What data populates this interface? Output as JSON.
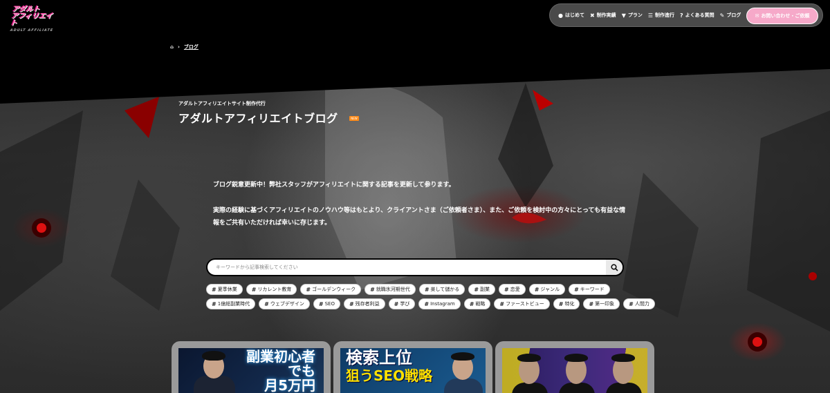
{
  "logo": {
    "text_line1": "アダルト",
    "text_line2": "アフィリエイト",
    "sub": "ADULT AFFILIATE"
  },
  "nav": {
    "items": [
      {
        "icon": "info-circle-icon",
        "glyph": "●",
        "label": "はじめて"
      },
      {
        "icon": "tools-icon",
        "glyph": "✖",
        "label": "制作実績"
      },
      {
        "icon": "funnel-icon",
        "glyph": "▼",
        "label": "プラン"
      },
      {
        "icon": "list-icon",
        "glyph": "☰",
        "label": "制作進行"
      },
      {
        "icon": "question-icon",
        "glyph": "?",
        "label": "よくある質問"
      },
      {
        "icon": "edit-icon",
        "glyph": "✎",
        "label": "ブログ"
      }
    ],
    "contact": {
      "icon": "mail-icon",
      "glyph": "✉",
      "label": "お問い合わせ・ご依頼"
    }
  },
  "breadcrumb": {
    "home_glyph": "⌂",
    "separator": "›",
    "current": "ブログ"
  },
  "hero": {
    "eyebrow": "アダルトアフィリエイトサイト制作代行",
    "title": "アダルトアフィリエイトブログ",
    "badge": "NEW",
    "intro_1": "ブログ鋭意更新中！弊社スタッフがアフィリエイトに関する記事を更新して参ります。",
    "intro_2": "実際の経験に基づくアフィリエイトのノウハウ等はもとより、クライアントさま（ご依頼者さま）、また、ご依頼を検討中の方々にとっても有益な情報をご共有いただければ幸いに存じます。"
  },
  "search": {
    "placeholder": "キーワードから記事検索してください",
    "button_glyph": "🔍"
  },
  "tags_row1": [
    "夏季休業",
    "リカレント教育",
    "ゴールデンウィーク",
    "就職氷河期世代",
    "楽して儲かる",
    "副業",
    "恋愛",
    "ジャンル",
    "キーワード"
  ],
  "tags_row2": [
    "1億総副業時代",
    "ウェブデザイン",
    "SEO",
    "残存者利益",
    "学び",
    "Instagram",
    "戦略",
    "ファーストビュー",
    "特化",
    "第一印象",
    "人間力"
  ],
  "cards": [
    {
      "text_1": "副業初心者",
      "text_2": "でも",
      "text_3": "月5万円"
    },
    {
      "text_1": "検索上位",
      "text_2": "狙うSEO戦略"
    },
    {
      "text_1": ""
    }
  ],
  "colors": {
    "accent_pink": "#f6a9c9",
    "logo_pink": "#ff4fa8",
    "badge_orange": "#ff8c1a"
  }
}
